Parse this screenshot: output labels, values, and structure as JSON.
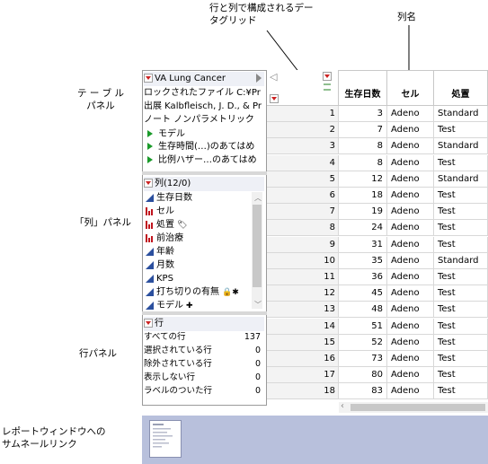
{
  "callouts": {
    "datagrid": "行と列で構成されるデー\nタグリッド",
    "column_name": "列名",
    "table_panel": "テ ー ブ ル\nパネル",
    "columns_panel": "「列」パネル",
    "rows_panel": "行パネル",
    "report_link": "レポートウィンドウへの\nサムネールリンク"
  },
  "table_panel": {
    "title": "VA Lung Cancer",
    "locked": "ロックされたファイル C:¥Pr",
    "source": "出展 Kalbfleisch, J. D., & Pr",
    "notes": "ノート ノンパラメトリック",
    "scripts": [
      "モデル",
      "生存時間(…)のあてはめ",
      "比例ハザー…のあてはめ"
    ]
  },
  "columns_panel": {
    "header": "列(12/0)",
    "columns": [
      {
        "name": "生存日数",
        "type": "continuous"
      },
      {
        "name": "セル",
        "type": "nominal"
      },
      {
        "name": "処置",
        "type": "nominal",
        "suffix": "🏷"
      },
      {
        "name": "前治療",
        "type": "nominal"
      },
      {
        "name": "年齢",
        "type": "continuous"
      },
      {
        "name": "月数",
        "type": "continuous"
      },
      {
        "name": "KPS",
        "type": "continuous"
      },
      {
        "name": "打ち切りの有無",
        "type": "continuous",
        "suffix": "🔒✱"
      },
      {
        "name": "モデル",
        "type": "continuous",
        "suffix": "✚"
      }
    ]
  },
  "rows_panel": {
    "header": "行",
    "stats": [
      {
        "label": "すべての行",
        "value": "137"
      },
      {
        "label": "選択されている行",
        "value": "0"
      },
      {
        "label": "除外されている行",
        "value": "0"
      },
      {
        "label": "表示しない行",
        "value": "0"
      },
      {
        "label": "ラベルのついた行",
        "value": "0"
      }
    ]
  },
  "grid": {
    "headers": [
      "生存日数",
      "セル",
      "処置"
    ],
    "rows": [
      [
        "1",
        "3",
        "Adeno",
        "Standard"
      ],
      [
        "2",
        "7",
        "Adeno",
        "Test"
      ],
      [
        "3",
        "8",
        "Adeno",
        "Standard"
      ],
      [
        "4",
        "8",
        "Adeno",
        "Test"
      ],
      [
        "5",
        "12",
        "Adeno",
        "Standard"
      ],
      [
        "6",
        "18",
        "Adeno",
        "Test"
      ],
      [
        "7",
        "19",
        "Adeno",
        "Test"
      ],
      [
        "8",
        "24",
        "Adeno",
        "Test"
      ],
      [
        "9",
        "31",
        "Adeno",
        "Test"
      ],
      [
        "10",
        "35",
        "Adeno",
        "Standard"
      ],
      [
        "11",
        "36",
        "Adeno",
        "Test"
      ],
      [
        "12",
        "45",
        "Adeno",
        "Test"
      ],
      [
        "13",
        "48",
        "Adeno",
        "Test"
      ],
      [
        "14",
        "51",
        "Adeno",
        "Test"
      ],
      [
        "15",
        "52",
        "Adeno",
        "Test"
      ],
      [
        "16",
        "73",
        "Adeno",
        "Test"
      ],
      [
        "17",
        "80",
        "Adeno",
        "Test"
      ],
      [
        "18",
        "83",
        "Adeno",
        "Test"
      ]
    ]
  },
  "colors": {
    "report_strip": "#b8c0dc",
    "nominal_icon": "#c0141e",
    "continuous_icon": "#2b4f9e",
    "script_icon": "#1a9a2a"
  }
}
